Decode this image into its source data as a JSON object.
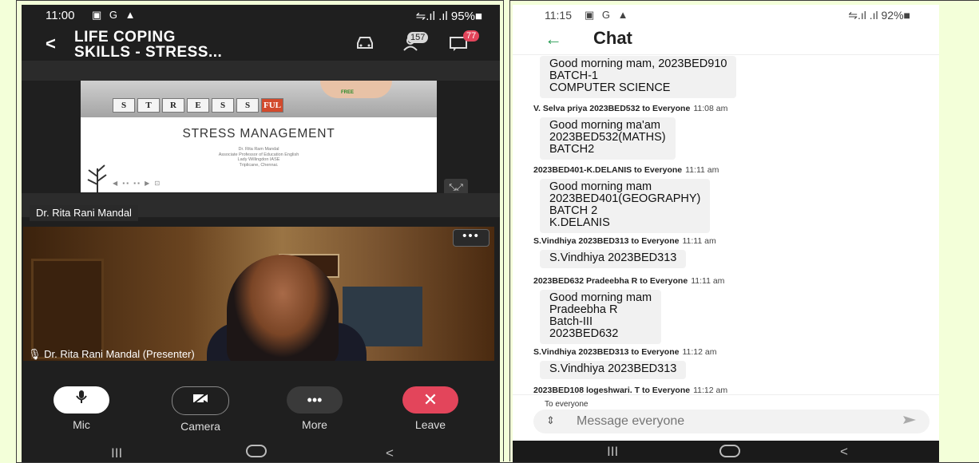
{
  "left": {
    "status": {
      "time": "11:00",
      "icons": "▣ G ▲",
      "right": "⇋.ıl .ıl 95%■"
    },
    "header": {
      "back": "<",
      "title_line1": "LIFE COPING",
      "title_line2": "SKILLS - STRESS...",
      "participants": "157",
      "chat_count": "77"
    },
    "slide": {
      "tiles": [
        "S",
        "T",
        "R",
        "E",
        "S",
        "S",
        "FUL"
      ],
      "free_label": "FREE",
      "heading": "STRESS MANAGEMENT",
      "author": "Dr. Rita Ram Mandal",
      "role": "Associate Professor of Education English",
      "institute": "Lady Willingdon IASE",
      "place": "Triplicane, Chennai."
    },
    "speaker_name": "Dr. Rita Rani Mandal",
    "presenter_label": "Dr. Rita Rani Mandal (Presenter)",
    "more_label": "•••",
    "controls": [
      {
        "label": "Mic",
        "icon": "🎙"
      },
      {
        "label": "Camera",
        "icon": "▰"
      },
      {
        "label": "More",
        "icon": "•••"
      },
      {
        "label": "Leave",
        "icon": "✕"
      }
    ]
  },
  "right": {
    "status": {
      "time": "11:15",
      "icons": "▣ G ▲",
      "right": "⇋.ıl .ıl 92%■"
    },
    "header": {
      "back": "←",
      "title": "Chat"
    },
    "messages": [
      {
        "meta": "",
        "time": "",
        "text": "Good morning mam, 2023BED910\nBATCH-1\nCOMPUTER SCIENCE"
      },
      {
        "meta": "V. Selva priya 2023BED532 to Everyone",
        "time": "11:08 am",
        "text": "Good morning ma'am\n2023BED532(MATHS)\nBATCH2"
      },
      {
        "meta": "2023BED401-K.DELANIS to Everyone",
        "time": "11:11 am",
        "text": "Good morning mam\n2023BED401(GEOGRAPHY)\nBATCH 2\nK.DELANIS"
      },
      {
        "meta": "S.Vindhiya 2023BED313 to Everyone",
        "time": "11:11 am",
        "text": "S.Vindhiya 2023BED313"
      },
      {
        "meta": "2023BED632 Pradeebha R  to Everyone",
        "time": "11:11 am",
        "text": "Good morning mam\nPradeebha R\nBatch-III\n2023BED632"
      },
      {
        "meta": "S.Vindhiya 2023BED313 to Everyone",
        "time": "11:12 am",
        "text": "S.Vindhiya 2023BED313"
      },
      {
        "meta": "2023BED108 logeshwari. T to Everyone",
        "time": "11:12 am",
        "text": ""
      }
    ],
    "to_label": "To everyone",
    "input_placeholder": "Message everyone"
  },
  "nav": {
    "recent": "III",
    "home": "○",
    "back": "<"
  }
}
